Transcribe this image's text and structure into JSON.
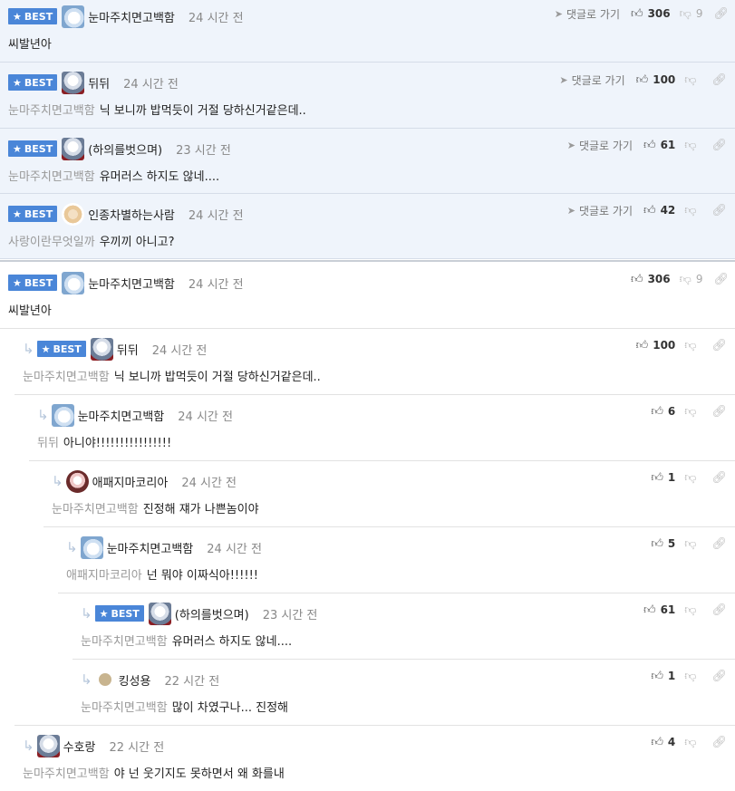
{
  "labels": {
    "best": "BEST",
    "goto": "댓글로 가기",
    "reply_arrow": "↳"
  },
  "icons": {
    "best_star": "★",
    "goto_arrow": "➤",
    "thumbs_up": "👍︎",
    "thumbs_down": "👎︎",
    "link": "🔗︎"
  },
  "colors": {
    "best_badge": "#4a86d8",
    "best_background": "#eff4fb"
  },
  "best_comments": [
    {
      "avatar": "ice",
      "nick": "눈마주치면고백함",
      "time": "24 시간 전",
      "up": "306",
      "down": "9",
      "mention": "",
      "text": "씨발년아"
    },
    {
      "avatar": "wolf",
      "nick": "뒤뒤",
      "time": "24 시간 전",
      "up": "100",
      "down": "",
      "mention": "눈마주치면고백함",
      "text": "닉 보니까 밥먹듯이 거절 당하신거같은데.."
    },
    {
      "avatar": "wolf",
      "nick": "(하의를벗으며)",
      "time": "23 시간 전",
      "up": "61",
      "down": "",
      "mention": "눈마주치면고백함",
      "text": "유머러스 하지도 않네...."
    },
    {
      "avatar": "dog",
      "nick": "인종차별하는사람",
      "time": "24 시간 전",
      "up": "42",
      "down": "",
      "mention": "사랑이란무엇일까",
      "text": "우끼끼 아니고?"
    }
  ],
  "thread": [
    {
      "best": true,
      "avatar": "ice",
      "nick": "눈마주치면고백함",
      "time": "24 시간 전",
      "up": "306",
      "down": "9",
      "mention": "",
      "text": "씨발년아"
    },
    {
      "best": true,
      "avatar": "wolf",
      "nick": "뒤뒤",
      "time": "24 시간 전",
      "up": "100",
      "down": "",
      "mention": "눈마주치면고백함",
      "text": "닉 보니까 밥먹듯이 거절 당하신거같은데.."
    },
    {
      "best": false,
      "avatar": "ice",
      "nick": "눈마주치면고백함",
      "time": "24 시간 전",
      "up": "6",
      "down": "",
      "mention": "뒤뒤",
      "text": "아니야!!!!!!!!!!!!!!!!"
    },
    {
      "best": false,
      "avatar": "girl",
      "nick": "애패지마코리아",
      "time": "24 시간 전",
      "up": "1",
      "down": "",
      "mention": "눈마주치면고백함",
      "text": "진정해 쟤가 나쁜놈이야"
    },
    {
      "best": false,
      "avatar": "ice",
      "nick": "눈마주치면고백함",
      "time": "24 시간 전",
      "up": "5",
      "down": "",
      "mention": "애패지마코리아",
      "text": "넌 뭐야 이짜식아!!!!!!"
    },
    {
      "best": true,
      "avatar": "wolf",
      "nick": "(하의를벗으며)",
      "time": "23 시간 전",
      "up": "61",
      "down": "",
      "mention": "눈마주치면고백함",
      "text": "유머러스 하지도 않네...."
    },
    {
      "best": false,
      "avatar": "dot",
      "nick": "킹성용",
      "time": "22 시간 전",
      "up": "1",
      "down": "",
      "mention": "눈마주치면고백함",
      "text": "많이 차였구나... 진정해"
    },
    {
      "best": false,
      "avatar": "wolf",
      "nick": "수호랑",
      "time": "22 시간 전",
      "up": "4",
      "down": "",
      "mention": "눈마주치면고백함",
      "text": "야 넌 웃기지도 못하면서 왜 화를내"
    }
  ]
}
